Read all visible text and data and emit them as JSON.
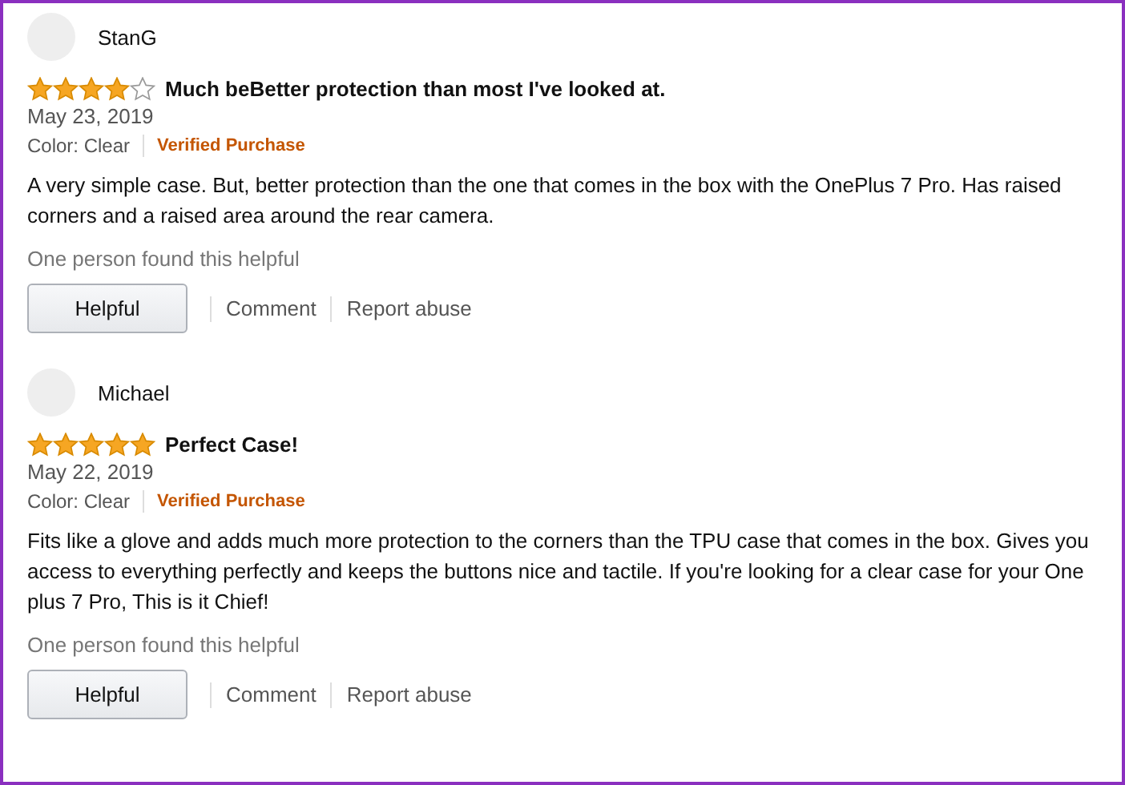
{
  "reviews": [
    {
      "author": "StanG",
      "stars": 4,
      "title": "Much beBetter protection than most I've looked at.",
      "date": "May 23, 2019",
      "variant": "Color: Clear",
      "badge": "Verified Purchase",
      "body": "A very simple case. But, better protection than the one that comes in the box with the OnePlus 7 Pro. Has raised corners and a raised area around the rear camera.",
      "helpful_count": "One person found this helpful",
      "actions": [
        "Helpful",
        "Comment",
        "Report abuse"
      ]
    },
    {
      "author": "Michael",
      "stars": 5,
      "title": "Perfect Case!",
      "date": "May 22, 2019",
      "variant": "Color: Clear",
      "badge": "Verified Purchase",
      "body": "Fits like a glove and adds much more protection to the corners than the TPU case that comes in the box. Gives you access to everything perfectly and keeps the buttons nice and tactile. If you're looking for a clear case for your One plus 7 Pro, This is it Chief!",
      "helpful_count": "One person found this helpful",
      "actions": [
        "Helpful",
        "Comment",
        "Report abuse"
      ]
    }
  ]
}
